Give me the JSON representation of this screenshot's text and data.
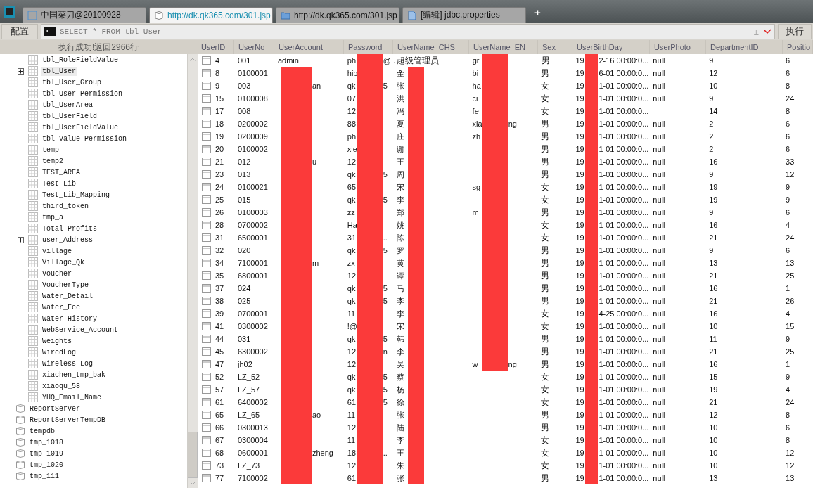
{
  "tabs": [
    {
      "label": "中国菜刀@20100928",
      "kind": "app",
      "selected": false
    },
    {
      "label": "http://dk.qk365.com/301.jsp",
      "kind": "database",
      "selected": true
    },
    {
      "label": "http://dk.qk365.com/301.jsp",
      "kind": "folder",
      "selected": false
    },
    {
      "label": "[编辑] jdbc.properties",
      "kind": "file",
      "selected": false
    }
  ],
  "new_tab": "+",
  "toolbar": {
    "config_button": "配置",
    "query": "SELECT * FROM tbl_User",
    "history_toggle": "±",
    "run_button": "执行"
  },
  "status": "执行成功!返回2966行",
  "tree": [
    {
      "label": "tbl_RoleFieldValue",
      "kind": "table",
      "expandable": false,
      "selected": false
    },
    {
      "label": "tbl_User",
      "kind": "table",
      "expandable": true,
      "selected": true
    },
    {
      "label": "tbl_User_Group",
      "kind": "table",
      "expandable": false,
      "selected": false
    },
    {
      "label": "tbl_User_Permission",
      "kind": "table",
      "expandable": false,
      "selected": false
    },
    {
      "label": "tbl_UserArea",
      "kind": "table",
      "expandable": false,
      "selected": false
    },
    {
      "label": "tbl_UserField",
      "kind": "table",
      "expandable": false,
      "selected": false
    },
    {
      "label": "tbl_UserFieldValue",
      "kind": "table",
      "expandable": false,
      "selected": false
    },
    {
      "label": "tbl_Value_Permission",
      "kind": "table",
      "expandable": false,
      "selected": false
    },
    {
      "label": "temp",
      "kind": "table",
      "expandable": false,
      "selected": false
    },
    {
      "label": "temp2",
      "kind": "table",
      "expandable": false,
      "selected": false
    },
    {
      "label": "TEST_AREA",
      "kind": "table",
      "expandable": false,
      "selected": false
    },
    {
      "label": "Test_Lib",
      "kind": "table",
      "expandable": false,
      "selected": false
    },
    {
      "label": "Test_Lib_Mapping",
      "kind": "table",
      "expandable": false,
      "selected": false
    },
    {
      "label": "third_token",
      "kind": "table",
      "expandable": false,
      "selected": false
    },
    {
      "label": "tmp_a",
      "kind": "table",
      "expandable": false,
      "selected": false
    },
    {
      "label": "Total_Profits",
      "kind": "table",
      "expandable": false,
      "selected": false
    },
    {
      "label": "user_Address",
      "kind": "table",
      "expandable": true,
      "selected": false
    },
    {
      "label": "village",
      "kind": "table",
      "expandable": false,
      "selected": false
    },
    {
      "label": "Village_Qk",
      "kind": "table",
      "expandable": false,
      "selected": false
    },
    {
      "label": "Voucher",
      "kind": "table",
      "expandable": false,
      "selected": false
    },
    {
      "label": "VoucherType",
      "kind": "table",
      "expandable": false,
      "selected": false
    },
    {
      "label": "Water_Detail",
      "kind": "table",
      "expandable": false,
      "selected": false
    },
    {
      "label": "Water_Fee",
      "kind": "table",
      "expandable": false,
      "selected": false
    },
    {
      "label": "Water_History",
      "kind": "table",
      "expandable": false,
      "selected": false
    },
    {
      "label": "WebService_Account",
      "kind": "table",
      "expandable": false,
      "selected": false
    },
    {
      "label": "Weights",
      "kind": "table",
      "expandable": false,
      "selected": false
    },
    {
      "label": "WiredLog",
      "kind": "table",
      "expandable": false,
      "selected": false
    },
    {
      "label": "Wireless_Log",
      "kind": "table",
      "expandable": false,
      "selected": false
    },
    {
      "label": "xiachen_tmp_bak",
      "kind": "table",
      "expandable": false,
      "selected": false
    },
    {
      "label": "xiaoqu_58",
      "kind": "table",
      "expandable": false,
      "selected": false
    },
    {
      "label": "YHQ_Email_Name",
      "kind": "table",
      "expandable": false,
      "selected": false
    },
    {
      "label": "ReportServer",
      "kind": "database",
      "expandable": false,
      "selected": false
    },
    {
      "label": "ReportServerTempDB",
      "kind": "database",
      "expandable": false,
      "selected": false
    },
    {
      "label": "tempdb",
      "kind": "database",
      "expandable": false,
      "selected": false
    },
    {
      "label": "tmp_1018",
      "kind": "database",
      "expandable": false,
      "selected": false
    },
    {
      "label": "tmp_1019",
      "kind": "database",
      "expandable": false,
      "selected": false
    },
    {
      "label": "tmp_1020",
      "kind": "database",
      "expandable": false,
      "selected": false
    },
    {
      "label": "tmp_111",
      "kind": "database",
      "expandable": false,
      "selected": false
    }
  ],
  "table": {
    "columns": [
      "UserID",
      "UserNo",
      "UserAccount",
      "Password",
      "UserName_CHS",
      "UserName_EN",
      "Sex",
      "UserBirthDay",
      "UserPhoto",
      "DepartmentID",
      "Positio"
    ],
    "rows": [
      {
        "cells": [
          "4",
          "001",
          "admin",
          {
            "redacted": true,
            "before": "ph",
            "after": "@ ."
          },
          "超级管理员",
          {
            "redacted": true,
            "before": "gr"
          },
          "男",
          {
            "redacted": true,
            "before": "19",
            "after": "2-16 00:00:0..."
          },
          "null",
          "9",
          "6"
        ]
      },
      {
        "cells": [
          "8",
          "0100001",
          {
            "redacted": true
          },
          {
            "redacted": true,
            "before": "hib"
          },
          {
            "redacted": true,
            "before": "金"
          },
          {
            "redacted": true,
            "before": "bi"
          },
          "男",
          {
            "redacted": true,
            "before": "19",
            "after": "6-01 00:00:0..."
          },
          "null",
          "12",
          "6"
        ]
      },
      {
        "cells": [
          "9",
          "003",
          {
            "redacted": true,
            "after": "an"
          },
          {
            "redacted": true,
            "before": "qk",
            "after": "5"
          },
          {
            "redacted": true,
            "before": "张"
          },
          {
            "redacted": true,
            "before": "ha"
          },
          "女",
          {
            "redacted": true,
            "before": "19",
            "after": "1-01 00:00:0..."
          },
          "null",
          "10",
          "8"
        ]
      },
      {
        "cells": [
          "15",
          "0100008",
          {
            "redacted": true
          },
          {
            "redacted": true,
            "before": "07"
          },
          {
            "redacted": true,
            "before": "洪"
          },
          {
            "redacted": true,
            "before": "ci"
          },
          "女",
          {
            "redacted": true,
            "before": "19",
            "after": "1-01 00:00:0..."
          },
          "null",
          "9",
          "24"
        ]
      },
      {
        "cells": [
          "17",
          "008",
          {
            "redacted": true
          },
          {
            "redacted": true,
            "before": "12"
          },
          {
            "redacted": true,
            "before": "冯"
          },
          {
            "redacted": true,
            "before": "fe"
          },
          "女",
          {
            "redacted": true,
            "before": "19",
            "after": "1-01 00:00:0..."
          },
          null,
          "14",
          "8"
        ]
      },
      {
        "cells": [
          "18",
          "0200002",
          {
            "redacted": true
          },
          {
            "redacted": true,
            "before": "88"
          },
          {
            "redacted": true,
            "before": "夏"
          },
          {
            "redacted": true,
            "before": "xia",
            "after": "ng"
          },
          "男",
          {
            "redacted": true,
            "before": "19",
            "after": "1-01 00:00:0..."
          },
          "null",
          "2",
          "6"
        ]
      },
      {
        "cells": [
          "19",
          "0200009",
          {
            "redacted": true
          },
          {
            "redacted": true,
            "before": "ph"
          },
          {
            "redacted": true,
            "before": "庄"
          },
          {
            "redacted": true,
            "before": "zh"
          },
          "男",
          {
            "redacted": true,
            "before": "19",
            "after": "1-01 00:00:0..."
          },
          "null",
          "2",
          "6"
        ]
      },
      {
        "cells": [
          "20",
          "0100002",
          {
            "redacted": true
          },
          {
            "redacted": true,
            "before": "xie"
          },
          {
            "redacted": true,
            "before": "谢"
          },
          {
            "redacted": true
          },
          "男",
          {
            "redacted": true,
            "before": "19",
            "after": "1-01 00:00:0..."
          },
          "null",
          "2",
          "6"
        ]
      },
      {
        "cells": [
          "21",
          "012",
          {
            "redacted": true,
            "after": "u"
          },
          {
            "redacted": true,
            "before": "12"
          },
          {
            "redacted": true,
            "before": "王"
          },
          {
            "redacted": true
          },
          "男",
          {
            "redacted": true,
            "before": "19",
            "after": "1-01 00:00:0..."
          },
          "null",
          "16",
          "33"
        ]
      },
      {
        "cells": [
          "23",
          "013",
          {
            "redacted": true
          },
          {
            "redacted": true,
            "before": "qk",
            "after": "5"
          },
          {
            "redacted": true,
            "before": "周"
          },
          {
            "redacted": true
          },
          "男",
          {
            "redacted": true,
            "before": "19",
            "after": "1-01 00:00:0..."
          },
          "null",
          "9",
          "12"
        ]
      },
      {
        "cells": [
          "24",
          "0100021",
          {
            "redacted": true
          },
          {
            "redacted": true,
            "before": "65"
          },
          {
            "redacted": true,
            "before": "宋"
          },
          {
            "redacted": true,
            "before": "sg"
          },
          "女",
          {
            "redacted": true,
            "before": "19",
            "after": "1-01 00:00:0..."
          },
          "null",
          "19",
          "9"
        ]
      },
      {
        "cells": [
          "25",
          "015",
          {
            "redacted": true
          },
          {
            "redacted": true,
            "before": "qk",
            "after": "5"
          },
          {
            "redacted": true,
            "before": "李"
          },
          {
            "redacted": true
          },
          "女",
          {
            "redacted": true,
            "before": "19",
            "after": "1-01 00:00:0..."
          },
          "null",
          "19",
          "9"
        ]
      },
      {
        "cells": [
          "26",
          "0100003",
          {
            "redacted": true
          },
          {
            "redacted": true,
            "before": "zz"
          },
          {
            "redacted": true,
            "before": "郑"
          },
          {
            "redacted": true,
            "before": "m"
          },
          "男",
          {
            "redacted": true,
            "before": "19",
            "after": "1-01 00:00:0..."
          },
          "null",
          "9",
          "6"
        ]
      },
      {
        "cells": [
          "28",
          "0700002",
          {
            "redacted": true
          },
          {
            "redacted": true,
            "before": "Ha"
          },
          {
            "redacted": true,
            "before": "姚"
          },
          {
            "redacted": true
          },
          "女",
          {
            "redacted": true,
            "before": "19",
            "after": "1-01 00:00:0..."
          },
          "null",
          "16",
          "4"
        ]
      },
      {
        "cells": [
          "31",
          "6500001",
          {
            "redacted": true
          },
          {
            "redacted": true,
            "before": "31",
            "after": ".."
          },
          {
            "redacted": true,
            "before": "陈"
          },
          {
            "redacted": true
          },
          "女",
          {
            "redacted": true,
            "before": "19",
            "after": "1-01 00:00:0..."
          },
          "null",
          "21",
          "24"
        ]
      },
      {
        "cells": [
          "32",
          "020",
          {
            "redacted": true
          },
          {
            "redacted": true,
            "before": "qk",
            "after": "5"
          },
          {
            "redacted": true,
            "before": "罗"
          },
          {
            "redacted": true
          },
          "男",
          {
            "redacted": true,
            "before": "19",
            "after": "1-01 00:00:0..."
          },
          "null",
          "9",
          "6"
        ]
      },
      {
        "cells": [
          "34",
          "7100001",
          {
            "redacted": true,
            "after": "m"
          },
          {
            "redacted": true,
            "before": "zx"
          },
          {
            "redacted": true,
            "before": "黄"
          },
          {
            "redacted": true
          },
          "男",
          {
            "redacted": true,
            "before": "19",
            "after": "1-01 00:00:0..."
          },
          "null",
          "13",
          "13"
        ]
      },
      {
        "cells": [
          "35",
          "6800001",
          {
            "redacted": true
          },
          {
            "redacted": true,
            "before": "12"
          },
          {
            "redacted": true,
            "before": "谭"
          },
          {
            "redacted": true
          },
          "男",
          {
            "redacted": true,
            "before": "19",
            "after": "1-01 00:00:0..."
          },
          "null",
          "21",
          "25"
        ]
      },
      {
        "cells": [
          "37",
          "024",
          {
            "redacted": true
          },
          {
            "redacted": true,
            "before": "qk",
            "after": "5"
          },
          {
            "redacted": true,
            "before": "马"
          },
          {
            "redacted": true
          },
          "男",
          {
            "redacted": true,
            "before": "19",
            "after": "1-01 00:00:0..."
          },
          "null",
          "16",
          "1"
        ]
      },
      {
        "cells": [
          "38",
          "025",
          {
            "redacted": true
          },
          {
            "redacted": true,
            "before": "qk",
            "after": "5"
          },
          {
            "redacted": true,
            "before": "李"
          },
          {
            "redacted": true
          },
          "男",
          {
            "redacted": true,
            "before": "19",
            "after": "1-01 00:00:0..."
          },
          "null",
          "21",
          "26"
        ]
      },
      {
        "cells": [
          "39",
          "0700001",
          {
            "redacted": true
          },
          {
            "redacted": true,
            "before": "11"
          },
          {
            "redacted": true,
            "before": "李"
          },
          {
            "redacted": true
          },
          "女",
          {
            "redacted": true,
            "before": "19",
            "after": "4-25 00:00:0..."
          },
          "null",
          "16",
          "4"
        ]
      },
      {
        "cells": [
          "41",
          "0300002",
          {
            "redacted": true
          },
          {
            "redacted": true,
            "before": "!@"
          },
          {
            "redacted": true,
            "before": "宋"
          },
          {
            "redacted": true
          },
          "女",
          {
            "redacted": true,
            "before": "19",
            "after": "1-01 00:00:0..."
          },
          "null",
          "10",
          "15"
        ]
      },
      {
        "cells": [
          "44",
          "031",
          {
            "redacted": true
          },
          {
            "redacted": true,
            "before": "qk",
            "after": "5"
          },
          {
            "redacted": true,
            "before": "韩"
          },
          {
            "redacted": true
          },
          "男",
          {
            "redacted": true,
            "before": "19",
            "after": "1-01 00:00:0..."
          },
          "null",
          "11",
          "9"
        ]
      },
      {
        "cells": [
          "45",
          "6300002",
          {
            "redacted": true
          },
          {
            "redacted": true,
            "before": "12",
            "after": "n"
          },
          {
            "redacted": true,
            "before": "李"
          },
          {
            "redacted": true
          },
          "男",
          {
            "redacted": true,
            "before": "19",
            "after": "1-01 00:00:0..."
          },
          "null",
          "21",
          "25"
        ]
      },
      {
        "cells": [
          "47",
          "jh02",
          {
            "redacted": true
          },
          {
            "redacted": true,
            "before": "12"
          },
          {
            "redacted": true,
            "before": "吴"
          },
          {
            "redacted": true,
            "before": "w",
            "after": "ng"
          },
          "男",
          {
            "redacted": true,
            "before": "19",
            "after": "1-01 00:00:0..."
          },
          "null",
          "16",
          "1"
        ]
      },
      {
        "cells": [
          "52",
          "LZ_52",
          {
            "redacted": true
          },
          {
            "redacted": true,
            "before": "qk",
            "after": "5"
          },
          {
            "redacted": true,
            "before": "蔡"
          },
          null,
          "女",
          {
            "redacted": true,
            "before": "19",
            "after": "1-01 00:00:0..."
          },
          "null",
          "15",
          "9"
        ]
      },
      {
        "cells": [
          "57",
          "LZ_57",
          {
            "redacted": true
          },
          {
            "redacted": true,
            "before": "qk",
            "after": "5"
          },
          {
            "redacted": true,
            "before": "杨"
          },
          null,
          "女",
          {
            "redacted": true,
            "before": "19",
            "after": "1-01 00:00:0..."
          },
          "null",
          "19",
          "4"
        ]
      },
      {
        "cells": [
          "61",
          "6400002",
          {
            "redacted": true
          },
          {
            "redacted": true,
            "before": "61",
            "after": "5"
          },
          {
            "redacted": true,
            "before": "徐"
          },
          null,
          "女",
          {
            "redacted": true,
            "before": "19",
            "after": "1-01 00:00:0..."
          },
          "null",
          "21",
          "24"
        ]
      },
      {
        "cells": [
          "65",
          "LZ_65",
          {
            "redacted": true,
            "after": "ao"
          },
          {
            "redacted": true,
            "before": "11"
          },
          {
            "redacted": true,
            "before": "张"
          },
          null,
          "男",
          {
            "redacted": true,
            "before": "19",
            "after": "1-01 00:00:0..."
          },
          "null",
          "12",
          "8"
        ]
      },
      {
        "cells": [
          "66",
          "0300013",
          {
            "redacted": true
          },
          {
            "redacted": true,
            "before": "12"
          },
          {
            "redacted": true,
            "before": "陆"
          },
          null,
          "男",
          {
            "redacted": true,
            "before": "19",
            "after": "1-01 00:00:0..."
          },
          "null",
          "10",
          "6"
        ]
      },
      {
        "cells": [
          "67",
          "0300004",
          {
            "redacted": true
          },
          {
            "redacted": true,
            "before": "11"
          },
          {
            "redacted": true,
            "before": "李"
          },
          null,
          "女",
          {
            "redacted": true,
            "before": "19",
            "after": "1-01 00:00:0..."
          },
          "null",
          "10",
          "8"
        ]
      },
      {
        "cells": [
          "68",
          "0600001",
          {
            "redacted": true,
            "after": "zheng"
          },
          {
            "redacted": true,
            "before": "18",
            "after": ".."
          },
          {
            "redacted": true,
            "before": "王"
          },
          null,
          "女",
          {
            "redacted": true,
            "before": "19",
            "after": "1-01 00:00:0..."
          },
          "null",
          "10",
          "12"
        ]
      },
      {
        "cells": [
          "73",
          "LZ_73",
          {
            "redacted": true
          },
          {
            "redacted": true,
            "before": "12"
          },
          {
            "redacted": true,
            "before": "朱"
          },
          null,
          "女",
          {
            "redacted": true,
            "before": "19",
            "after": "1-01 00:00:0..."
          },
          "null",
          "10",
          "12"
        ]
      },
      {
        "cells": [
          "77",
          "7100002",
          {
            "redacted": true
          },
          {
            "redacted": true,
            "before": "61"
          },
          {
            "redacted": true,
            "before": "张"
          },
          null,
          "男",
          {
            "redacted": true,
            "before": "19",
            "after": "1-01 00:00:0..."
          },
          "null",
          "13",
          "13"
        ]
      }
    ]
  }
}
